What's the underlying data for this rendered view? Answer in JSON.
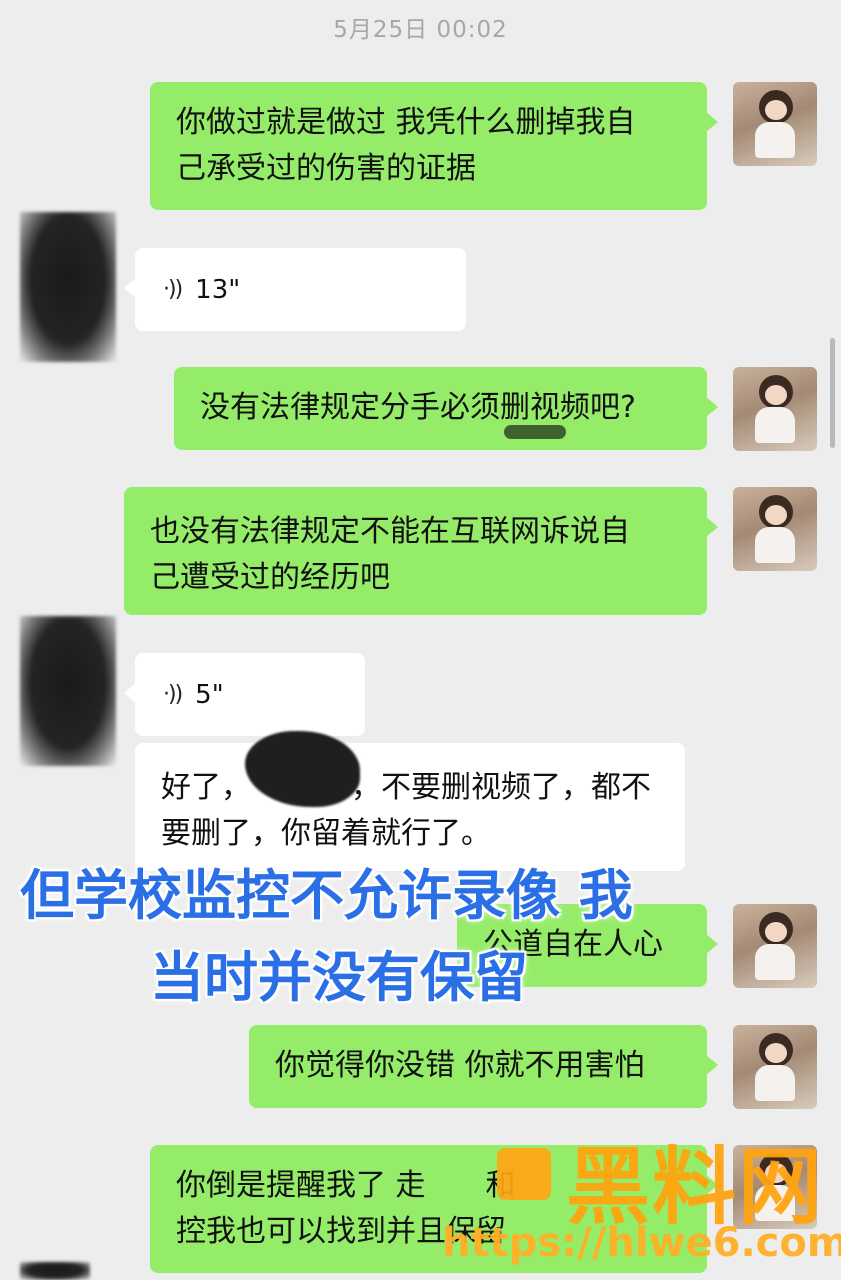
{
  "chat": {
    "timestamp": "5月25日 00:02",
    "messages": [
      {
        "id": "m1",
        "sender": "me",
        "lines": [
          "你做过就是做过 我凭什么删掉我自",
          "己承受过的伤害的证据"
        ]
      },
      {
        "id": "m2",
        "sender": "other",
        "type": "voice",
        "duration": "13\""
      },
      {
        "id": "m3",
        "sender": "me",
        "lines": [
          "没有法律规定分手必须删视频吧?"
        ]
      },
      {
        "id": "m4",
        "sender": "me",
        "lines": [
          "也没有法律规定不能在互联网诉说自",
          "己遭受过的经历吧"
        ]
      },
      {
        "id": "m5",
        "sender": "other",
        "type": "voice",
        "duration": "5\""
      },
      {
        "id": "m6",
        "sender": "other",
        "lines": [
          "好了，",
          "，不要删视频了，都不",
          "要删了，你留着就行了。"
        ]
      },
      {
        "id": "m7",
        "sender": "me",
        "lines": [
          "公道自在人心"
        ]
      },
      {
        "id": "m8",
        "sender": "me",
        "lines": [
          "你觉得你没错 你就不用害怕"
        ]
      },
      {
        "id": "m9",
        "sender": "me",
        "lines": [
          "你倒是提醒我了 走",
          "和",
          "控我也可以找到并且保留"
        ]
      }
    ]
  },
  "overlay": {
    "line1": "但学校监控不允许录像 我",
    "line2": "当时并没有保留",
    "color": "#2b6fe6"
  },
  "watermark": {
    "brand": "黑料网",
    "url": "https://hlwe6.com",
    "color": "#ffa310"
  },
  "icons": {
    "voice": "voice-wave-icon"
  }
}
